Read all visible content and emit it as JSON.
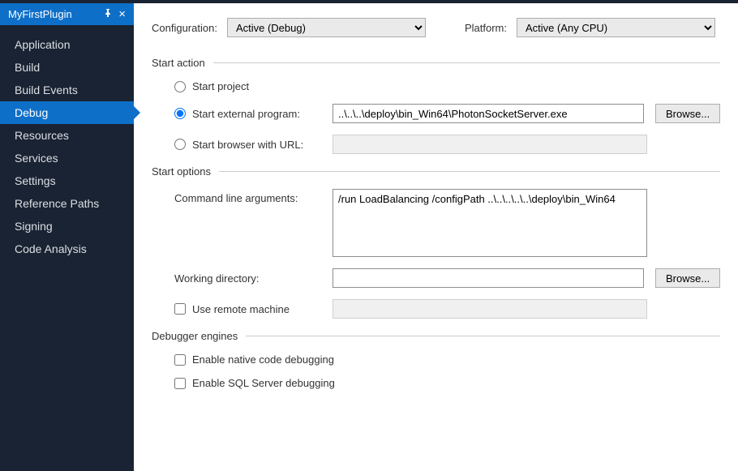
{
  "tab": {
    "title": "MyFirstPlugin",
    "pin_glyph": "⇵",
    "close_glyph": "×"
  },
  "nav": {
    "items": [
      {
        "label": "Application",
        "active": false
      },
      {
        "label": "Build",
        "active": false
      },
      {
        "label": "Build Events",
        "active": false
      },
      {
        "label": "Debug",
        "active": true
      },
      {
        "label": "Resources",
        "active": false
      },
      {
        "label": "Services",
        "active": false
      },
      {
        "label": "Settings",
        "active": false
      },
      {
        "label": "Reference Paths",
        "active": false
      },
      {
        "label": "Signing",
        "active": false
      },
      {
        "label": "Code Analysis",
        "active": false
      }
    ]
  },
  "config": {
    "configuration_label": "Configuration:",
    "configuration_value": "Active (Debug)",
    "platform_label": "Platform:",
    "platform_value": "Active (Any CPU)"
  },
  "sections": {
    "start_action": {
      "title": "Start action",
      "start_project": "Start project",
      "start_external": "Start external program:",
      "external_value": "..\\..\\..\\deploy\\bin_Win64\\PhotonSocketServer.exe",
      "browse": "Browse...",
      "start_browser": "Start browser with URL:",
      "browser_value": "",
      "selected": "external"
    },
    "start_options": {
      "title": "Start options",
      "cmd_label": "Command line arguments:",
      "cmd_value": "/run LoadBalancing /configPath ..\\..\\..\\..\\..\\deploy\\bin_Win64",
      "workdir_label": "Working directory:",
      "workdir_value": "",
      "browse": "Browse...",
      "remote_label": "Use remote machine",
      "remote_checked": false,
      "remote_value": ""
    },
    "debugger_engines": {
      "title": "Debugger engines",
      "native_label": "Enable native code debugging",
      "native_checked": false,
      "sql_label": "Enable SQL Server debugging",
      "sql_checked": false
    }
  }
}
